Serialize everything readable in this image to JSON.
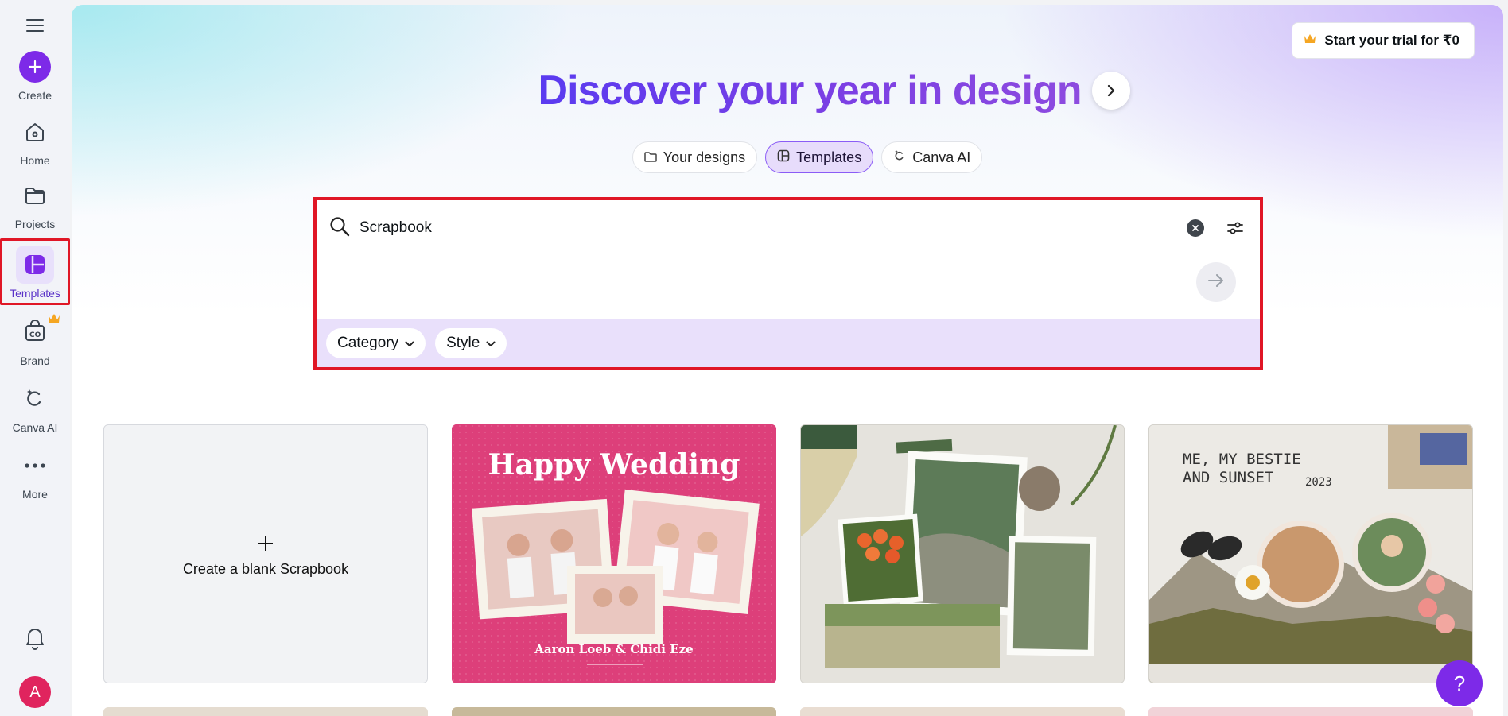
{
  "sidebar": {
    "create_label": "Create",
    "items": [
      {
        "label": "Home"
      },
      {
        "label": "Projects"
      },
      {
        "label": "Templates"
      },
      {
        "label": "Brand"
      },
      {
        "label": "Canva AI"
      },
      {
        "label": "More"
      }
    ],
    "avatar_letter": "A"
  },
  "header": {
    "trial_label": "Start your trial for ₹0",
    "headline": "Discover your year in design"
  },
  "tabs": [
    {
      "label": "Your designs",
      "active": false
    },
    {
      "label": "Templates",
      "active": true
    },
    {
      "label": "Canva AI",
      "active": false
    }
  ],
  "search": {
    "value": "Scrapbook",
    "filters": [
      {
        "label": "Category"
      },
      {
        "label": "Style"
      }
    ]
  },
  "grid": {
    "blank_label": "Create a blank Scrapbook",
    "cards": [
      {
        "title": "Happy Wedding",
        "subtitle": "Aaron Loeb & Chidi Eze"
      },
      {
        "title": ""
      },
      {
        "title": "ME, MY BESTIE\nAND SUNSET",
        "year": "2023"
      }
    ]
  },
  "help_label": "?",
  "colors": {
    "brand": "#7d2ae8",
    "highlight": "#e01626",
    "active_tab_bg": "#e7dcfb",
    "filter_bar": "#e9e0fb"
  }
}
